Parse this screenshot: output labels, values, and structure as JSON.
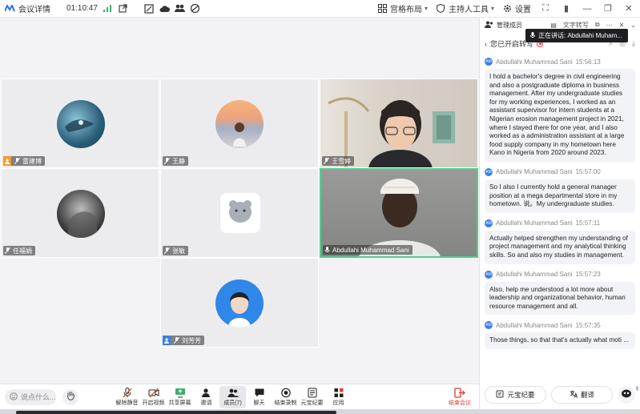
{
  "topbar": {
    "meeting_label": "会议详情",
    "timer": "01:10:47",
    "layout_label": "宫格布局",
    "host_tools_label": "主持人工具",
    "settings_label": "设置"
  },
  "participants": [
    {
      "name": "雷建博"
    },
    {
      "name": "王静"
    },
    {
      "name": "王雪婷"
    },
    {
      "name": "任福娟"
    },
    {
      "name": "张敏"
    },
    {
      "name": "Abdullahi Muhammad Sani"
    },
    {
      "name": "刘芳芳"
    }
  ],
  "toolbar": {
    "say_placeholder": "说点什么...",
    "items": [
      {
        "label": "解除静音"
      },
      {
        "label": "开启视频"
      },
      {
        "label": "共享屏幕"
      },
      {
        "label": "邀请"
      },
      {
        "label": "成员(7)"
      },
      {
        "label": "聊天"
      },
      {
        "label": "结束录制"
      },
      {
        "label": "元宝纪要"
      },
      {
        "label": "应用"
      }
    ],
    "end_label": "结束会议"
  },
  "panel": {
    "tab_members": "管理成员",
    "tab_transcribe": "文字转写",
    "speaking_tooltip": "正在讲话:  Abdullahi Muham...",
    "transcribe_status": "您已开启转写",
    "messages": [
      {
        "initials": "AM",
        "speaker": "Abdullahi Muhammad Sani",
        "time": "15:56:13",
        "text": "I hold a bachelor's degree in civil engineering and also a postgraduate diploma in business management. After my undergraduate studies for my working experiences, I worked as an assistant supervisor for intern students at a Nigerian erosion management project in 2021, where I stayed there for one year, and I also worked as a administration assistant at a large food supply company in my hometown here Kano in Nigeria from 2020 around 2023."
      },
      {
        "initials": "AM",
        "speaker": "Abdullahi Muhammad Sani",
        "time": "15:57:00",
        "text": "So I also I currently hold a general manager position at a mega departmental store in my hometown. 说。My undergraduate studies."
      },
      {
        "initials": "AM",
        "speaker": "Abdullahi Muhammad Sani",
        "time": "15:57:11",
        "text": "Actually helped strengthen my understanding of project management and my analytical thinking skills. So and also my studies in management."
      },
      {
        "initials": "AM",
        "speaker": "Abdullahi Muhammad Sani",
        "time": "15:57:23",
        "text": "Also, help me understood a lot more about leadership and organizational behavior, human resource management and all."
      },
      {
        "initials": "AM",
        "speaker": "Abdullahi Muhammad Sani",
        "time": "15:57:35",
        "text": "Those things, so that that's actually what moti ..."
      }
    ],
    "btn_summary": "元宝纪要",
    "btn_translate": "翻译"
  },
  "colors": {
    "accent": "#3b7ee8",
    "active_speaker": "#4fcf8f",
    "end_red": "#e03b2e",
    "host_badge": "#f29b2f"
  }
}
